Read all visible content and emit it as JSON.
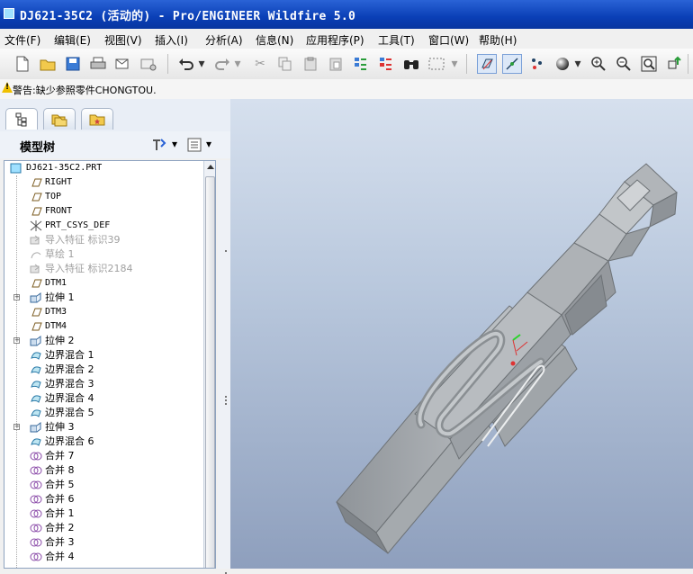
{
  "window": {
    "title": "DJ621-35C2 (活动的) - Pro/ENGINEER Wildfire 5.0"
  },
  "menu": {
    "items": [
      "文件(F)",
      "编辑(E)",
      "视图(V)",
      "插入(I)",
      "分析(A)",
      "信息(N)",
      "应用程序(P)",
      "工具(T)",
      "窗口(W)",
      "帮助(H)"
    ]
  },
  "message": {
    "text": "警告:缺少参照零件CHONGTOU."
  },
  "panel": {
    "title": "模型树"
  },
  "tree": {
    "root": "DJ621-35C2.PRT",
    "items": [
      {
        "label": "RIGHT",
        "kind": "plane"
      },
      {
        "label": "TOP",
        "kind": "plane"
      },
      {
        "label": "FRONT",
        "kind": "plane"
      },
      {
        "label": "PRT_CSYS_DEF",
        "kind": "csys"
      },
      {
        "label": "导入特征 标识39",
        "kind": "import",
        "grey": true
      },
      {
        "label": "草绘 1",
        "kind": "sketch",
        "grey": true
      },
      {
        "label": "导入特征 标识2184",
        "kind": "import",
        "grey": true
      },
      {
        "label": "DTM1",
        "kind": "plane"
      },
      {
        "label": "拉伸 1",
        "kind": "extrude",
        "expand": true
      },
      {
        "label": "DTM3",
        "kind": "plane"
      },
      {
        "label": "DTM4",
        "kind": "plane"
      },
      {
        "label": "拉伸 2",
        "kind": "extrude",
        "expand": true
      },
      {
        "label": "边界混合 1",
        "kind": "blend"
      },
      {
        "label": "边界混合 2",
        "kind": "blend"
      },
      {
        "label": "边界混合 3",
        "kind": "blend"
      },
      {
        "label": "边界混合 4",
        "kind": "blend"
      },
      {
        "label": "边界混合 5",
        "kind": "blend"
      },
      {
        "label": "拉伸 3",
        "kind": "extrude",
        "expand": true
      },
      {
        "label": "边界混合 6",
        "kind": "blend"
      },
      {
        "label": "合并 7",
        "kind": "merge"
      },
      {
        "label": "合并 8",
        "kind": "merge"
      },
      {
        "label": "合并 5",
        "kind": "merge"
      },
      {
        "label": "合并 6",
        "kind": "merge"
      },
      {
        "label": "合并 1",
        "kind": "merge"
      },
      {
        "label": "合并 2",
        "kind": "merge"
      },
      {
        "label": "合并 3",
        "kind": "merge"
      },
      {
        "label": "合并 4",
        "kind": "merge"
      }
    ]
  },
  "colors": {
    "titlebar": "#0a3fb6",
    "model": "#a9aeb3",
    "viewport_top": "#d6e0ee",
    "viewport_bottom": "#8e9fbd"
  }
}
